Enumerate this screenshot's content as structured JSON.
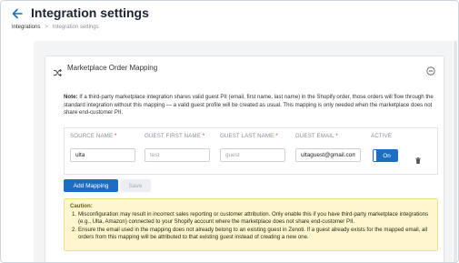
{
  "header": {
    "title": "Integration settings",
    "breadcrumb": {
      "parent": "Integrations",
      "separator": ">",
      "current": "Integration settings"
    }
  },
  "card": {
    "title": "Marketplace Order Mapping",
    "note_label": "Note:",
    "note_text": "If a third-party marketplace integration shares valid guest PII (email, first name, last name) in the Shopify order, those orders will flow through the standard integration without this mapping — a valid guest profile will be created as usual. This mapping is only needed when the marketplace does not share end-customer PII."
  },
  "mapping_table": {
    "columns": {
      "source_name": "SOURCE NAME",
      "guest_first_name": "GUEST FIRST NAME",
      "guest_last_name": "GUEST LAST NAME",
      "guest_email": "GUEST EMAIL",
      "active": "ACTIVE"
    },
    "required_marker": "*",
    "row": {
      "source_name_value": "ulta",
      "first_name_placeholder": "test",
      "last_name_placeholder": "guest",
      "email_value": "ultaguest@gmail.com",
      "active_label": "On"
    }
  },
  "buttons": {
    "add_mapping": "Add Mapping",
    "save": "Save"
  },
  "caution": {
    "title": "Caution:",
    "items": [
      {
        "num": "1.",
        "text": "Misconfiguration may result in incorrect sales reporting or customer attribution. Only enable this if you have third-party marketplace integrations (e.g., Ulta, Amazon) connected to your Shopify account where the marketplace does not share end-customer PII."
      },
      {
        "num": "2.",
        "text": "Ensure the email used in the mapping does not already belong to an existing guest in Zenoti. If a guest already exists for the mapped email, all orders from this mapping will be attributed to that existing guest instead of creating a new one."
      }
    ]
  },
  "colors": {
    "primary": "#1b6ec2",
    "required": "#d23b3b",
    "caution_bg": "#fdf6cf",
    "caution_border": "#eedf8e",
    "disabled_bg": "#eceef1"
  },
  "icons": [
    "back-arrow-icon",
    "shuffle-icon",
    "collapse-minus-icon",
    "trash-icon"
  ]
}
